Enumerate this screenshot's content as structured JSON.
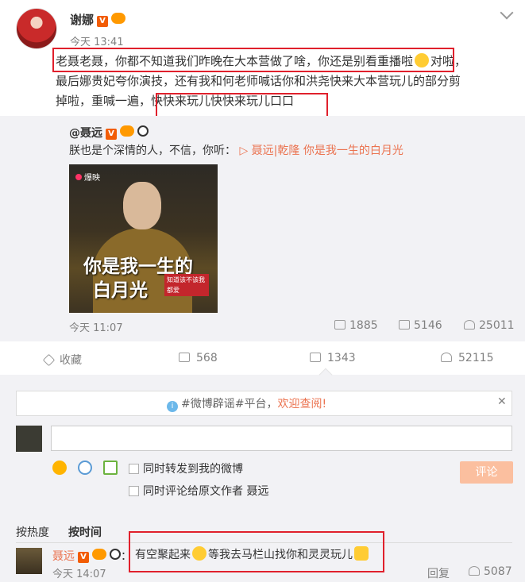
{
  "post": {
    "username": "谢娜",
    "v_badge": "V",
    "time": "今天 13:41",
    "text_line1": "老聂老聂，你都不知道我们昨晚在大本营做了啥，你还是别看重播啦",
    "text_line1_end": "对啦，",
    "text_line2": "最后娜贵妃夸你演技，还有我和何老师喊话你和洪尧快来大本营玩儿的部分剪",
    "text_line3a": "掉啦，重喊一遍，",
    "text_line3b": "快快来玩儿快快来玩儿口口"
  },
  "repost": {
    "user": "@聂远",
    "v_badge": "V",
    "text": "朕也是个深情的人，不信，你听：",
    "music": "▷ 聂远|乾隆 你是我一生的白月光",
    "thumb_logo": "爆映",
    "thumb_caption1": "你是我一生的",
    "thumb_caption2": "白月光",
    "thumb_stamp": "知道该不该我都爱",
    "time": "今天 11:07",
    "shares": "1885",
    "comments": "5146",
    "likes": "25011"
  },
  "actions": {
    "favorite": "收藏",
    "shares": "568",
    "comments": "1343",
    "likes": "52115"
  },
  "notice": {
    "prefix": "#微博辟谣#平台，",
    "link": "欢迎查阅!",
    "close": "✕"
  },
  "composer": {
    "forward_label": "同时转发到我的微博",
    "comment_origin_label": "同时评论给原文作者 聂远",
    "submit": "评论"
  },
  "sort": {
    "hot": "按热度",
    "time": "按时间"
  },
  "comment": {
    "user": "聂远",
    "v_badge": "V",
    "sep": "：",
    "text_a": "有空聚起来",
    "text_b": "等我去马栏山找你和灵灵玩儿",
    "time": "今天 14:07",
    "reply": "回复",
    "likes": "5087"
  },
  "colors": {
    "accent": "#eb7350",
    "highlight_box": "#e0202c",
    "repost_bg": "#f2f2f5"
  }
}
